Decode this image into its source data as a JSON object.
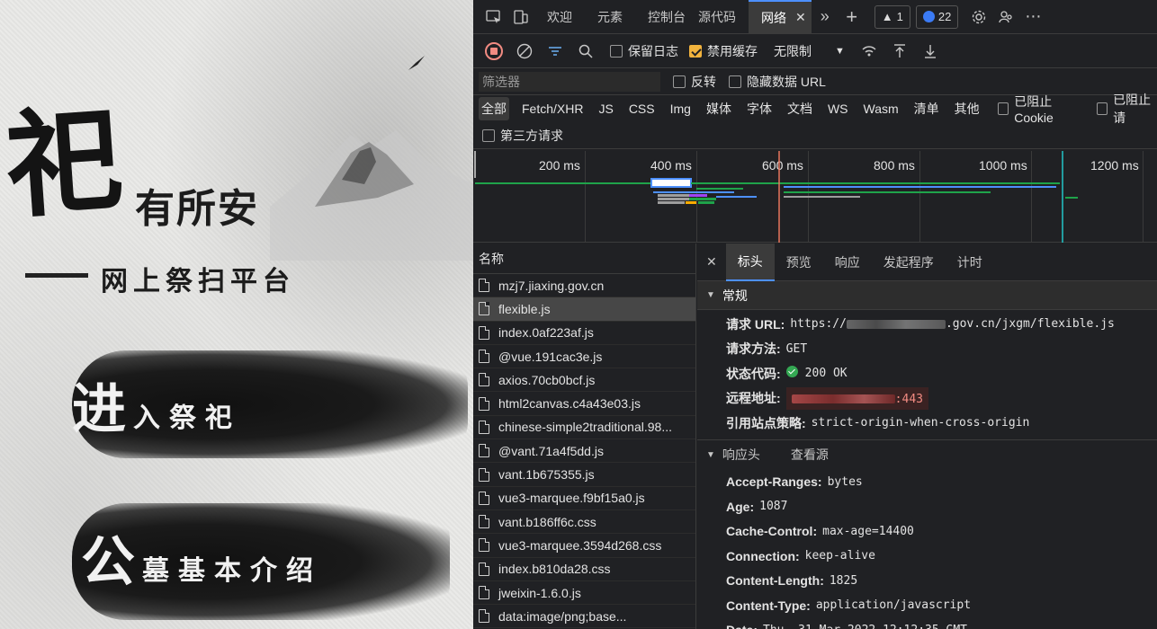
{
  "page": {
    "big_char": "祀",
    "title": "有所安",
    "subtitle": "网上祭扫平台",
    "button1": {
      "big": "进",
      "small": "入祭祀"
    },
    "button2": {
      "big": "公",
      "small": "墓基本介绍"
    }
  },
  "devtools": {
    "tabs": [
      {
        "label": "欢迎"
      },
      {
        "label": "元素"
      },
      {
        "label": "控制台"
      },
      {
        "label": "源代码"
      },
      {
        "label": "网络",
        "active": true
      }
    ],
    "warning_count": "1",
    "issue_count": "22",
    "toolbar": {
      "preserve_log": "保留日志",
      "disable_cache": "禁用缓存",
      "disable_cache_checked": true,
      "throttle": "无限制"
    },
    "filter": {
      "placeholder": "筛选器",
      "invert": "反转",
      "hide_data_urls": "隐藏数据 URL"
    },
    "types": [
      "全部",
      "Fetch/XHR",
      "JS",
      "CSS",
      "Img",
      "媒体",
      "字体",
      "文档",
      "WS",
      "Wasm",
      "清单",
      "其他"
    ],
    "blocked_cookies": "已阻止 Cookie",
    "blocked_requests": "已阻止请",
    "third_party": "第三方请求",
    "timeline_ticks": [
      "200 ms",
      "400 ms",
      "600 ms",
      "800 ms",
      "1000 ms",
      "1200 ms"
    ],
    "name_header": "名称",
    "requests": [
      "mzj7.jiaxing.gov.cn",
      "flexible.js",
      "index.0af223af.js",
      "@vue.191cac3e.js",
      "axios.70cb0bcf.js",
      "html2canvas.c4a43e03.js",
      "chinese-simple2traditional.98...",
      "@vant.71a4f5dd.js",
      "vant.1b675355.js",
      "vue3-marquee.f9bf15a0.js",
      "vant.b186ff6c.css",
      "vue3-marquee.3594d268.css",
      "index.b810da28.css",
      "jweixin-1.6.0.js",
      "data:image/png;base..."
    ],
    "selected_index": 1,
    "detail_tabs": [
      "标头",
      "预览",
      "响应",
      "发起程序",
      "计时"
    ],
    "general": {
      "title": "常规",
      "request_url_key": "请求 URL:",
      "request_url_prefix": "https://",
      "request_url_suffix": ".gov.cn/jxgm/flexible.js",
      "method_key": "请求方法:",
      "method": "GET",
      "status_key": "状态代码:",
      "status": "200 OK",
      "remote_key": "远程地址:",
      "remote_suffix": ":443",
      "referrer_key": "引用站点策略:",
      "referrer": "strict-origin-when-cross-origin"
    },
    "response_headers": {
      "title": "响应头",
      "view_source": "查看源",
      "items": [
        {
          "k": "Accept-Ranges:",
          "v": "bytes"
        },
        {
          "k": "Age:",
          "v": "1087"
        },
        {
          "k": "Cache-Control:",
          "v": "max-age=14400"
        },
        {
          "k": "Connection:",
          "v": "keep-alive"
        },
        {
          "k": "Content-Length:",
          "v": "1825"
        },
        {
          "k": "Content-Type:",
          "v": "application/javascript"
        },
        {
          "k": "Date:",
          "v": "Thu, 31 Mar 2022 12:12:35 GMT"
        }
      ]
    }
  }
}
